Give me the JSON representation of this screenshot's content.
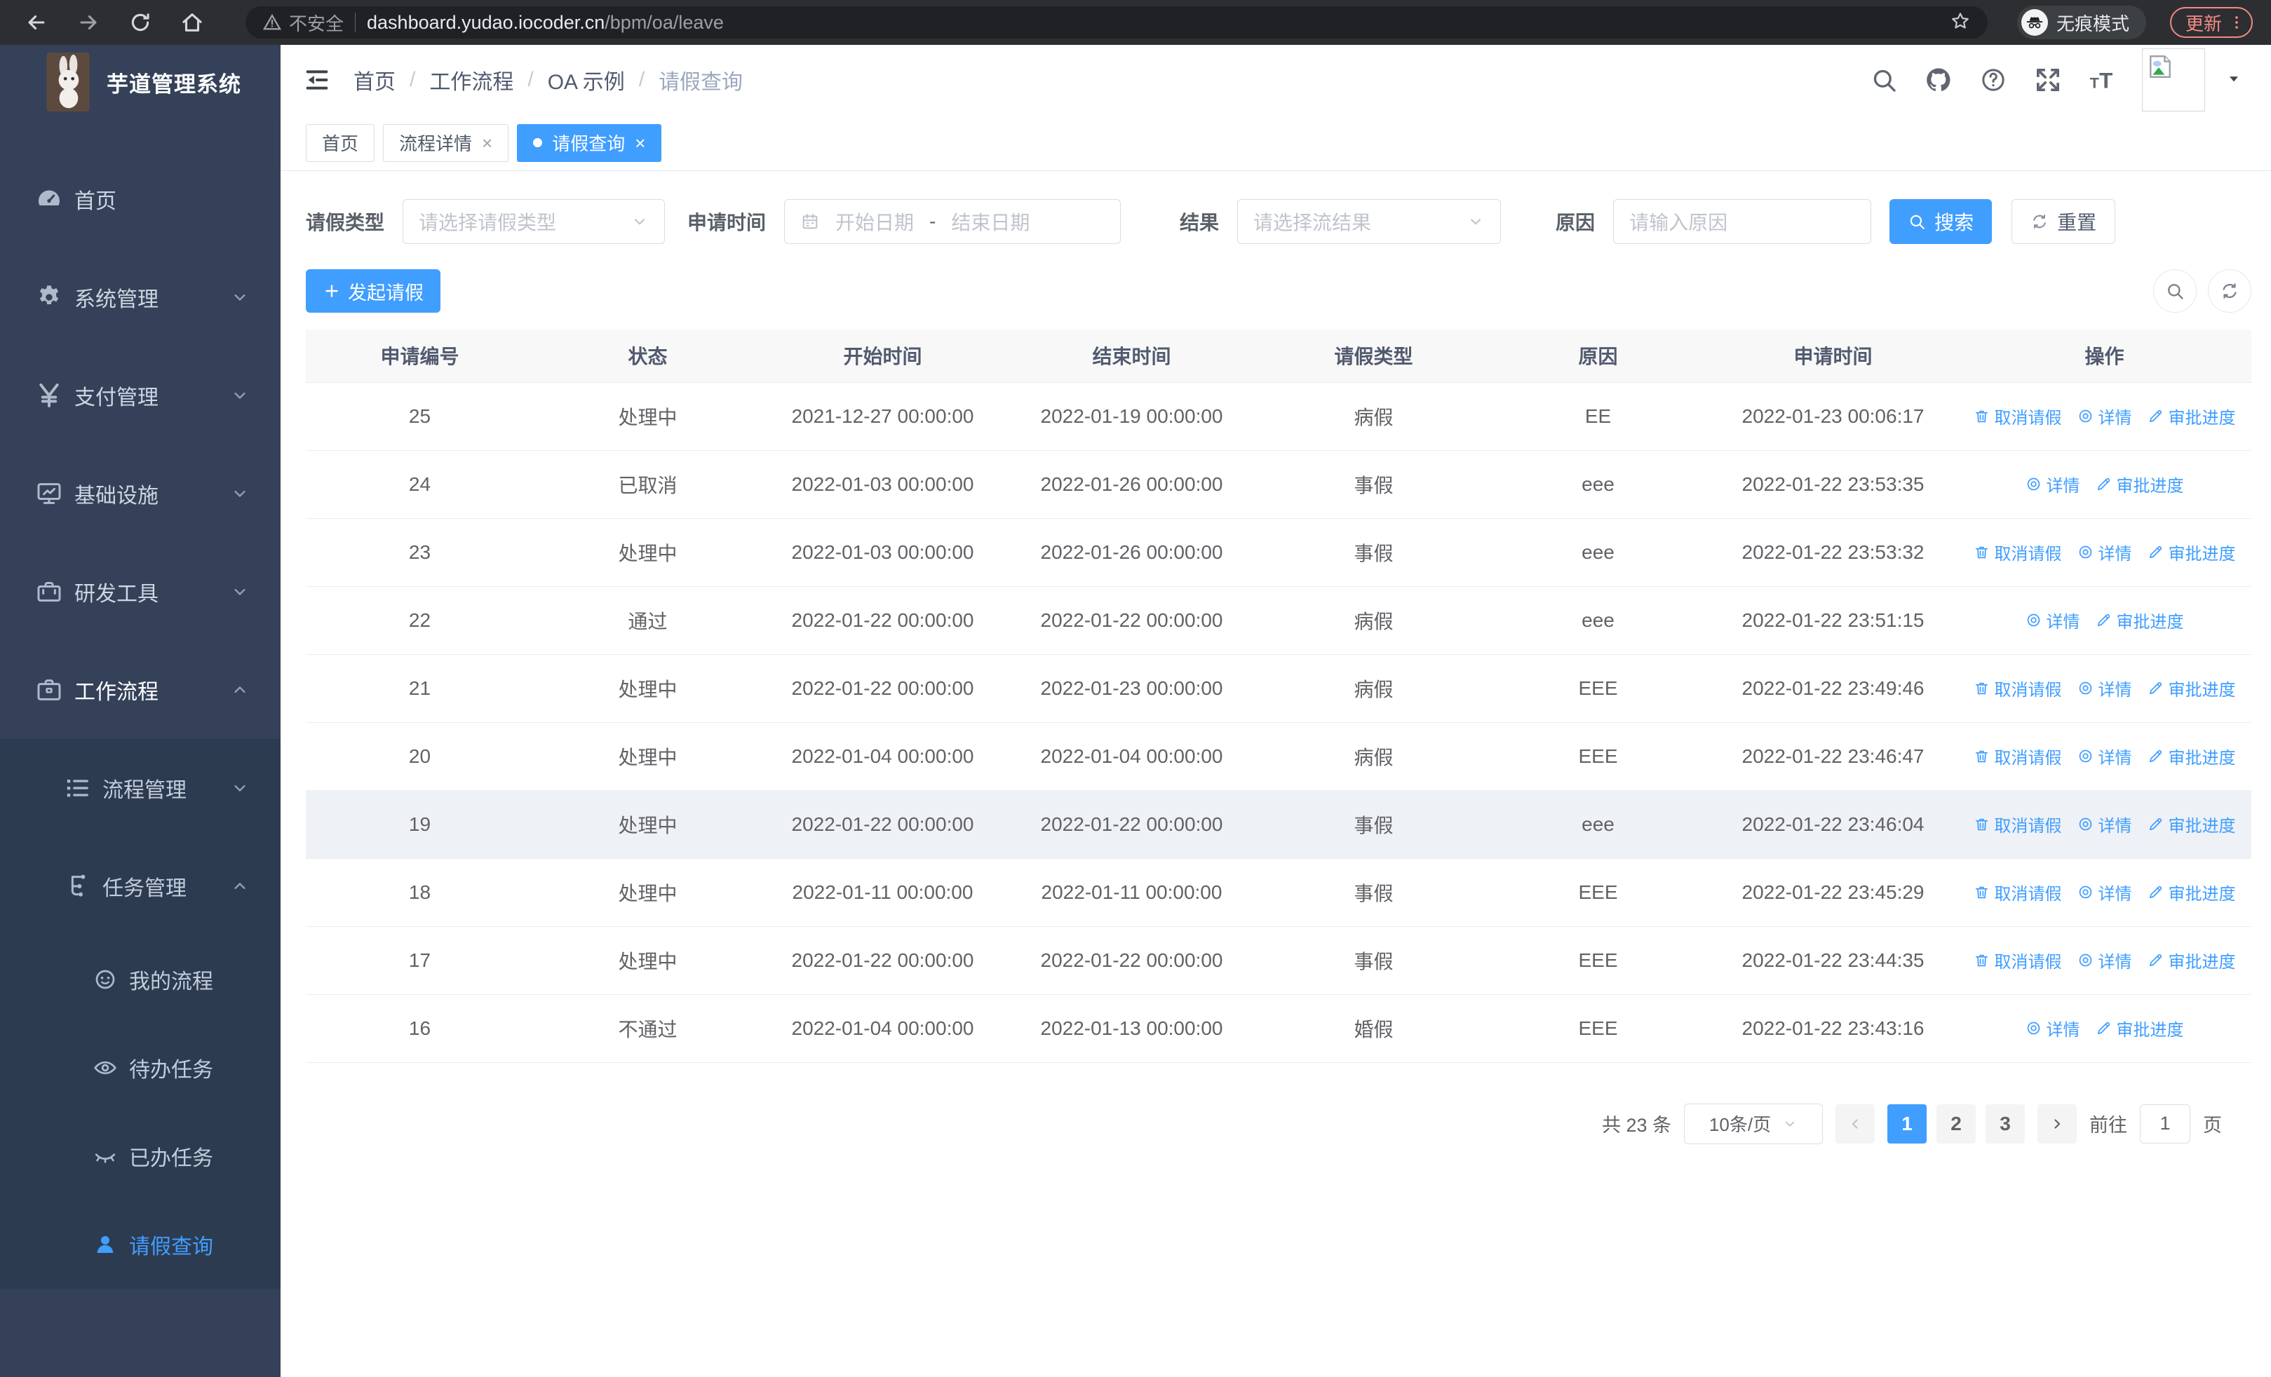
{
  "browser": {
    "security_label": "不安全",
    "url_host": "dashboard.yudao.iocoder.cn",
    "url_path": "/bpm/oa/leave",
    "incognito_label": "无痕模式",
    "update_label": "更新"
  },
  "sidebar": {
    "logo_title": "芋道管理系统",
    "menu": [
      {
        "label": "首页",
        "icon": "dashboard",
        "level": 1
      },
      {
        "label": "系统管理",
        "icon": "gear",
        "level": 1,
        "arrow": "down"
      },
      {
        "label": "支付管理",
        "icon": "yen",
        "level": 1,
        "arrow": "down"
      },
      {
        "label": "基础设施",
        "icon": "monitor",
        "level": 1,
        "arrow": "down"
      },
      {
        "label": "研发工具",
        "icon": "toolbox",
        "level": 1,
        "arrow": "down"
      },
      {
        "label": "工作流程",
        "icon": "briefcase",
        "level": 1,
        "arrow": "up",
        "trail": true
      },
      {
        "label": "流程管理",
        "icon": "list",
        "level": 2,
        "arrow": "down"
      },
      {
        "label": "任务管理",
        "icon": "flow",
        "level": 2,
        "arrow": "up"
      },
      {
        "label": "我的流程",
        "icon": "robot",
        "level": 3
      },
      {
        "label": "待办任务",
        "icon": "eye",
        "level": 3
      },
      {
        "label": "已办任务",
        "icon": "eyeclosed",
        "level": 3
      },
      {
        "label": "请假查询",
        "icon": "user",
        "level": 3,
        "active": true
      }
    ]
  },
  "header": {
    "breadcrumb": [
      "首页",
      "工作流程",
      "OA 示例",
      "请假查询"
    ]
  },
  "tabs": [
    {
      "label": "首页",
      "closable": false,
      "active": false
    },
    {
      "label": "流程详情",
      "closable": true,
      "active": false
    },
    {
      "label": "请假查询",
      "closable": true,
      "active": true
    }
  ],
  "filters": {
    "leave_type_label": "请假类型",
    "leave_type_placeholder": "请选择请假类型",
    "apply_time_label": "申请时间",
    "date_start_placeholder": "开始日期",
    "date_separator": "-",
    "date_end_placeholder": "结束日期",
    "result_label": "结果",
    "result_placeholder": "请选择流结果",
    "reason_label": "原因",
    "reason_placeholder": "请输入原因",
    "search_button": "搜索",
    "reset_button": "重置"
  },
  "toolbar": {
    "create_button": "发起请假"
  },
  "table": {
    "columns": [
      "申请编号",
      "状态",
      "开始时间",
      "结束时间",
      "请假类型",
      "原因",
      "申请时间",
      "操作"
    ],
    "action_labels": {
      "cancel": "取消请假",
      "detail": "详情",
      "progress": "审批进度"
    },
    "rows": [
      {
        "id": "25",
        "status": "处理中",
        "start": "2021-12-27 00:00:00",
        "end": "2022-01-19 00:00:00",
        "type": "病假",
        "reason": "EE",
        "apply": "2022-01-23 00:06:17",
        "actions": [
          "cancel",
          "detail",
          "progress"
        ],
        "hover": false
      },
      {
        "id": "24",
        "status": "已取消",
        "start": "2022-01-03 00:00:00",
        "end": "2022-01-26 00:00:00",
        "type": "事假",
        "reason": "eee",
        "apply": "2022-01-22 23:53:35",
        "actions": [
          "detail",
          "progress"
        ],
        "hover": false
      },
      {
        "id": "23",
        "status": "处理中",
        "start": "2022-01-03 00:00:00",
        "end": "2022-01-26 00:00:00",
        "type": "事假",
        "reason": "eee",
        "apply": "2022-01-22 23:53:32",
        "actions": [
          "cancel",
          "detail",
          "progress"
        ],
        "hover": false
      },
      {
        "id": "22",
        "status": "通过",
        "start": "2022-01-22 00:00:00",
        "end": "2022-01-22 00:00:00",
        "type": "病假",
        "reason": "eee",
        "apply": "2022-01-22 23:51:15",
        "actions": [
          "detail",
          "progress"
        ],
        "hover": false
      },
      {
        "id": "21",
        "status": "处理中",
        "start": "2022-01-22 00:00:00",
        "end": "2022-01-23 00:00:00",
        "type": "病假",
        "reason": "EEE",
        "apply": "2022-01-22 23:49:46",
        "actions": [
          "cancel",
          "detail",
          "progress"
        ],
        "hover": false
      },
      {
        "id": "20",
        "status": "处理中",
        "start": "2022-01-04 00:00:00",
        "end": "2022-01-04 00:00:00",
        "type": "病假",
        "reason": "EEE",
        "apply": "2022-01-22 23:46:47",
        "actions": [
          "cancel",
          "detail",
          "progress"
        ],
        "hover": false
      },
      {
        "id": "19",
        "status": "处理中",
        "start": "2022-01-22 00:00:00",
        "end": "2022-01-22 00:00:00",
        "type": "事假",
        "reason": "eee",
        "apply": "2022-01-22 23:46:04",
        "actions": [
          "cancel",
          "detail",
          "progress"
        ],
        "hover": true
      },
      {
        "id": "18",
        "status": "处理中",
        "start": "2022-01-11 00:00:00",
        "end": "2022-01-11 00:00:00",
        "type": "事假",
        "reason": "EEE",
        "apply": "2022-01-22 23:45:29",
        "actions": [
          "cancel",
          "detail",
          "progress"
        ],
        "hover": false
      },
      {
        "id": "17",
        "status": "处理中",
        "start": "2022-01-22 00:00:00",
        "end": "2022-01-22 00:00:00",
        "type": "事假",
        "reason": "EEE",
        "apply": "2022-01-22 23:44:35",
        "actions": [
          "cancel",
          "detail",
          "progress"
        ],
        "hover": false
      },
      {
        "id": "16",
        "status": "不通过",
        "start": "2022-01-04 00:00:00",
        "end": "2022-01-13 00:00:00",
        "type": "婚假",
        "reason": "EEE",
        "apply": "2022-01-22 23:43:16",
        "actions": [
          "detail",
          "progress"
        ],
        "hover": false
      }
    ]
  },
  "pagination": {
    "total": "共 23 条",
    "page_size": "10条/页",
    "pages": [
      "1",
      "2",
      "3"
    ],
    "current": "1",
    "goto_label": "前往",
    "goto_value": "1",
    "goto_suffix": "页"
  },
  "colors": {
    "primary": "#409eff",
    "sidebar_bg": "#344158",
    "update_accent": "#f28b82"
  }
}
